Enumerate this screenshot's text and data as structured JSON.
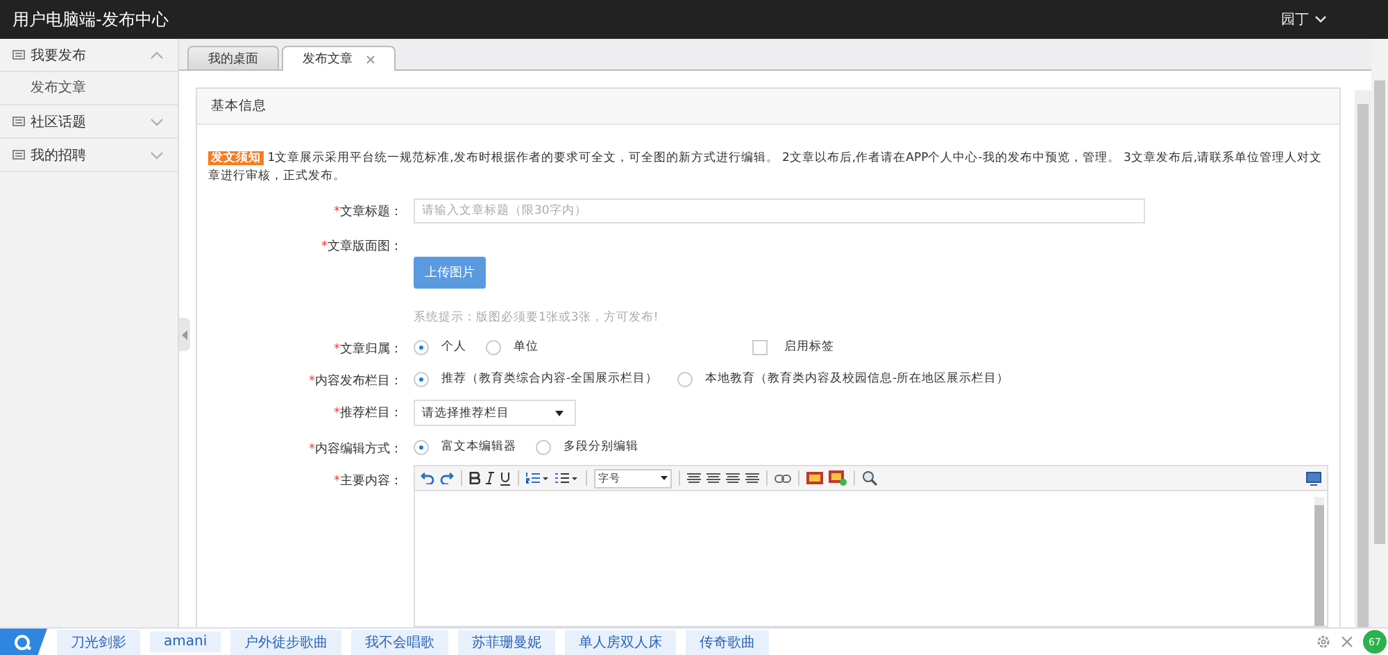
{
  "header": {
    "title": "用户电脑端-发布中心",
    "user": "园丁"
  },
  "sidebar": {
    "items": [
      {
        "label": "我要发布",
        "expanded": true,
        "children": [
          {
            "label": "发布文章"
          }
        ]
      },
      {
        "label": "社区话题",
        "expanded": false
      },
      {
        "label": "我的招聘",
        "expanded": false
      }
    ]
  },
  "tabs": [
    {
      "label": "我的桌面",
      "selected": false,
      "closable": false
    },
    {
      "label": "发布文章",
      "selected": true,
      "closable": true
    }
  ],
  "panel": {
    "title": "基本信息",
    "notice": {
      "tag": "发文须知",
      "text": "1文章展示采用平台统一规范标准,发布时根据作者的要求可全文，可全图的新方式进行编辑。 2文章以布后,作者请在APP个人中心-我的发布中预览，管理。 3文章发布后,请联系单位管理人对文章进行审核，正式发布。"
    },
    "fields": [
      {
        "kind": "input",
        "label": "文章标题：",
        "required_mark": "*",
        "placeholder": "请输入文章标题（限30字内）"
      },
      {
        "kind": "upload",
        "label": "文章版面图：",
        "required_mark": "*",
        "button": "上传图片",
        "hint": "系统提示：版图必须要1张或3张，方可发布!"
      },
      {
        "kind": "radio",
        "label": "文章归属：",
        "required_mark": "*",
        "options": [
          {
            "label": "个人",
            "selected": true
          },
          {
            "label": "单位",
            "selected": false
          }
        ],
        "checkbox": {
          "label": "启用标签",
          "checked": false
        }
      },
      {
        "kind": "radio",
        "label": "内容发布栏目：",
        "required_mark": "*",
        "options": [
          {
            "label": "推荐（教育类综合内容-全国展示栏目）",
            "selected": true
          },
          {
            "label": "本地教育（教育类内容及校园信息-所在地区展示栏目）",
            "selected": false
          }
        ]
      },
      {
        "kind": "select",
        "label": "推荐栏目：",
        "required_mark": "*",
        "value": "请选择推荐栏目"
      },
      {
        "kind": "radio",
        "label": "内容编辑方式：",
        "required_mark": "*",
        "options": [
          {
            "label": "富文本编辑器",
            "selected": true
          },
          {
            "label": "多段分别编辑",
            "selected": false
          }
        ]
      },
      {
        "kind": "editor",
        "label": "主要内容：",
        "required_mark": "*",
        "font_size": "字号"
      }
    ]
  },
  "search_bar": {
    "tags": [
      "刀光剑影",
      "amani",
      "户外徒步歌曲",
      "我不会唱歌",
      "苏菲珊曼妮",
      "单人房双人床",
      "传奇歌曲"
    ]
  },
  "badge": "67"
}
